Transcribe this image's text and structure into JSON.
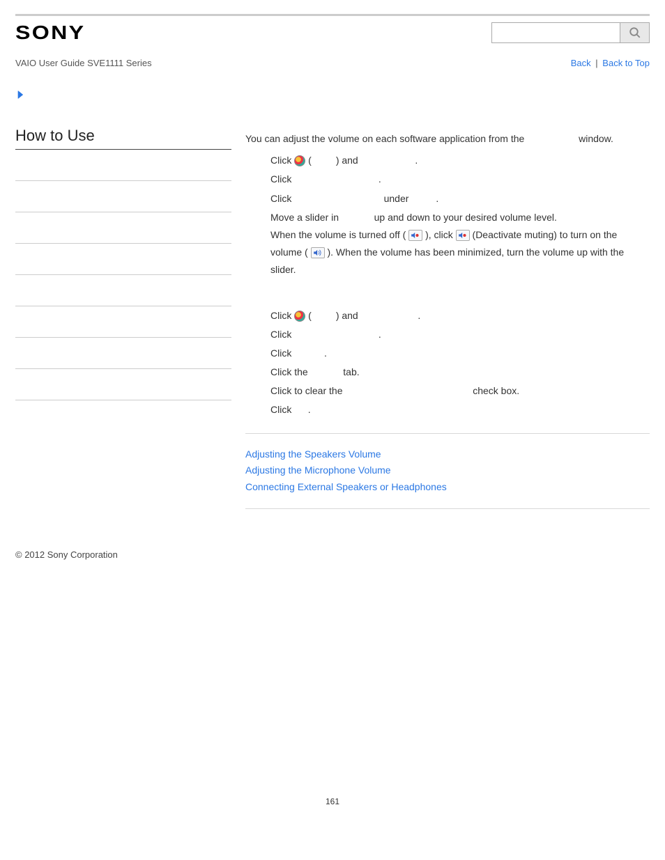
{
  "header": {
    "logo_text": "SONY",
    "search_placeholder": ""
  },
  "sub": {
    "guide_title": "VAIO User Guide SVE1111 Series",
    "back_label": "Back",
    "back_top_label": "Back to Top"
  },
  "sidebar": {
    "title": "How to Use",
    "items_count": 8
  },
  "content": {
    "intro_prefix": "You can adjust the volume on each software application from the ",
    "intro_suffix": " window.",
    "steps1": {
      "s1_a": "Click ",
      "s1_b": " (",
      "s1_c": ") and ",
      "s1_d": ".",
      "s2_a": "Click ",
      "s2_b": ".",
      "s3_a": "Click ",
      "s3_b": " under ",
      "s3_c": ".",
      "s4_a": "Move a slider in ",
      "s4_b": " up and down to your desired volume level.",
      "s4_c": "When the volume is turned off (",
      "s4_d": "), click ",
      "s4_e": " (Deactivate muting) to turn on the volume (",
      "s4_f": "). When the volume has been minimized, turn the volume up with the slider."
    },
    "steps2": {
      "s1_a": "Click ",
      "s1_b": " (",
      "s1_c": ") and ",
      "s1_d": ".",
      "s2_a": "Click ",
      "s2_b": ".",
      "s3_a": "Click ",
      "s3_b": ".",
      "s4_a": "Click the ",
      "s4_b": " tab.",
      "s5_a": "Click to clear the ",
      "s5_b": " check box.",
      "s6_a": "Click ",
      "s6_b": "."
    },
    "related": {
      "r1": "Adjusting the Speakers Volume",
      "r2": "Adjusting the Microphone Volume",
      "r3": "Connecting External Speakers or Headphones"
    }
  },
  "footer": {
    "copyright": "© 2012 Sony Corporation"
  },
  "page_number": "161"
}
